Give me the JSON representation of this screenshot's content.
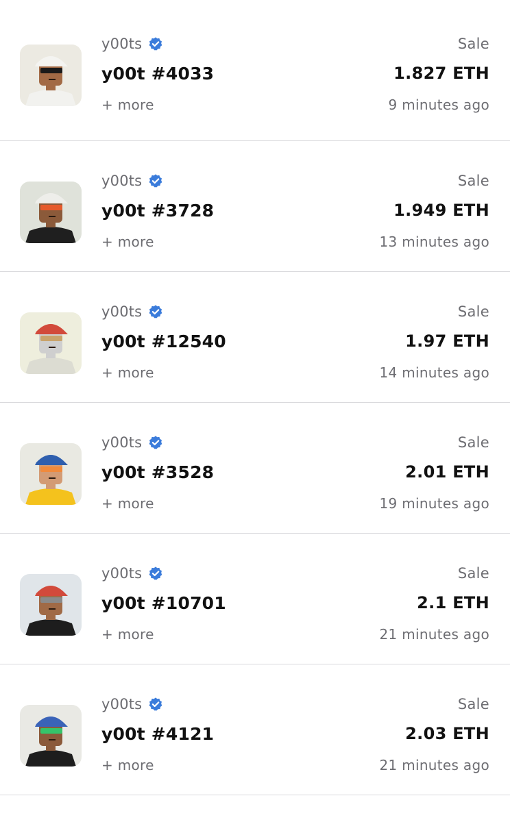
{
  "accent": "#3b7cdb",
  "rows": [
    {
      "collection": "y00ts",
      "verified_icon": "verified-badge-icon",
      "name": "y00t #4033",
      "more": "+ more",
      "event": "Sale",
      "price": "1.827 ETH",
      "time": "9 minutes ago",
      "thumb_bg": "#eceae2",
      "outfit": "#f2f2ef",
      "headwear": "#f4f4f1",
      "eyes": "#1a1a1a",
      "skin": "#a26a45"
    },
    {
      "collection": "y00ts",
      "verified_icon": "verified-badge-icon",
      "name": "y00t #3728",
      "more": "+ more",
      "event": "Sale",
      "price": "1.949 ETH",
      "time": "13 minutes ago",
      "thumb_bg": "#dfe2da",
      "outfit": "#1f1f1f",
      "headwear": "#eeeeea",
      "eyes": "#e55a2b",
      "skin": "#8b5a3a"
    },
    {
      "collection": "y00ts",
      "verified_icon": "verified-badge-icon",
      "name": "y00t #12540",
      "more": "+ more",
      "event": "Sale",
      "price": "1.97 ETH",
      "time": "14 minutes ago",
      "thumb_bg": "#eeeedd",
      "outfit": "#dcdcd2",
      "headwear": "#d24a3b",
      "eyes": "#c9a36b",
      "skin": "#cfcfcf"
    },
    {
      "collection": "y00ts",
      "verified_icon": "verified-badge-icon",
      "name": "y00t #3528",
      "more": "+ more",
      "event": "Sale",
      "price": "2.01 ETH",
      "time": "19 minutes ago",
      "thumb_bg": "#e9e9e2",
      "outfit": "#f4c21d",
      "headwear": "#2f5fae",
      "eyes": "#f08a3c",
      "skin": "#d39b74"
    },
    {
      "collection": "y00ts",
      "verified_icon": "verified-badge-icon",
      "name": "y00t #10701",
      "more": "+ more",
      "event": "Sale",
      "price": "2.1 ETH",
      "time": "21 minutes ago",
      "thumb_bg": "#e0e5e9",
      "outfit": "#1d1d1d",
      "headwear": "#d24a3b",
      "eyes": "#8a8a8a",
      "skin": "#a06a46"
    },
    {
      "collection": "y00ts",
      "verified_icon": "verified-badge-icon",
      "name": "y00t #4121",
      "more": "+ more",
      "event": "Sale",
      "price": "2.03 ETH",
      "time": "21 minutes ago",
      "thumb_bg": "#e9e9e4",
      "outfit": "#1d1d1d",
      "headwear": "#3a63b8",
      "eyes": "#35c46a",
      "skin": "#8b5a3a"
    }
  ]
}
